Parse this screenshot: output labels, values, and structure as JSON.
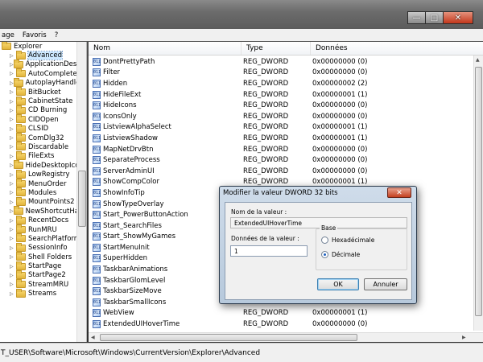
{
  "menu": {
    "items": [
      "age",
      "Favoris",
      "?"
    ]
  },
  "window_controls": {
    "minimize": "—",
    "maximize": "□",
    "close": "✕"
  },
  "tree": {
    "root": "Explorer",
    "items": [
      "Advanced",
      "ApplicationDestina",
      "AutoComplete",
      "AutoplayHandlers",
      "BitBucket",
      "CabinetState",
      "CD Burning",
      "CIDOpen",
      "CLSID",
      "ComDlg32",
      "Discardable",
      "FileExts",
      "HideDesktopIcons",
      "LowRegistry",
      "MenuOrder",
      "Modules",
      "MountPoints2",
      "NewShortcutHand",
      "RecentDocs",
      "RunMRU",
      "SearchPlatform",
      "SessionInfo",
      "Shell Folders",
      "StartPage",
      "StartPage2",
      "StreamMRU",
      "Streams"
    ],
    "selected": "Advanced"
  },
  "columns": {
    "name": "Nom",
    "type": "Type",
    "data": "Données"
  },
  "rows": [
    {
      "name": "DontPrettyPath",
      "type": "REG_DWORD",
      "data": "0x00000000 (0)"
    },
    {
      "name": "Filter",
      "type": "REG_DWORD",
      "data": "0x00000000 (0)"
    },
    {
      "name": "Hidden",
      "type": "REG_DWORD",
      "data": "0x00000002 (2)"
    },
    {
      "name": "HideFileExt",
      "type": "REG_DWORD",
      "data": "0x00000001 (1)"
    },
    {
      "name": "HideIcons",
      "type": "REG_DWORD",
      "data": "0x00000000 (0)"
    },
    {
      "name": "IconsOnly",
      "type": "REG_DWORD",
      "data": "0x00000000 (0)"
    },
    {
      "name": "ListviewAlphaSelect",
      "type": "REG_DWORD",
      "data": "0x00000001 (1)"
    },
    {
      "name": "ListviewShadow",
      "type": "REG_DWORD",
      "data": "0x00000001 (1)"
    },
    {
      "name": "MapNetDrvBtn",
      "type": "REG_DWORD",
      "data": "0x00000000 (0)"
    },
    {
      "name": "SeparateProcess",
      "type": "REG_DWORD",
      "data": "0x00000000 (0)"
    },
    {
      "name": "ServerAdminUI",
      "type": "REG_DWORD",
      "data": "0x00000000 (0)"
    },
    {
      "name": "ShowCompColor",
      "type": "REG_DWORD",
      "data": "0x00000001 (1)"
    },
    {
      "name": "ShowInfoTip",
      "type": "REG_DWORD",
      "data": ""
    },
    {
      "name": "ShowTypeOverlay",
      "type": "",
      "data": ""
    },
    {
      "name": "Start_PowerButtonAction",
      "type": "",
      "data": ""
    },
    {
      "name": "Start_SearchFiles",
      "type": "",
      "data": ""
    },
    {
      "name": "Start_ShowMyGames",
      "type": "",
      "data": ""
    },
    {
      "name": "StartMenuInit",
      "type": "",
      "data": ""
    },
    {
      "name": "SuperHidden",
      "type": "",
      "data": ""
    },
    {
      "name": "TaskbarAnimations",
      "type": "",
      "data": ""
    },
    {
      "name": "TaskbarGlomLevel",
      "type": "",
      "data": ""
    },
    {
      "name": "TaskbarSizeMove",
      "type": "",
      "data": ""
    },
    {
      "name": "TaskbarSmallIcons",
      "type": "",
      "data": ""
    },
    {
      "name": "WebView",
      "type": "REG_DWORD",
      "data": "0x00000001 (1)"
    },
    {
      "name": "ExtendedUIHoverTime",
      "type": "REG_DWORD",
      "data": "0x00000000 (0)"
    }
  ],
  "status_path": "T_USER\\Software\\Microsoft\\Windows\\CurrentVersion\\Explorer\\Advanced",
  "dialog": {
    "title": "Modifier la valeur DWORD 32 bits",
    "close": "✕",
    "name_label": "Nom de la valeur :",
    "name_value": "ExtendedUIHoverTime",
    "data_label": "Données de la valeur :",
    "data_value": "1",
    "base_label": "Base",
    "hex_label": "Hexadécimale",
    "dec_label": "Décimale",
    "base_selected": "Décimale",
    "ok": "OK",
    "cancel": "Annuler"
  }
}
